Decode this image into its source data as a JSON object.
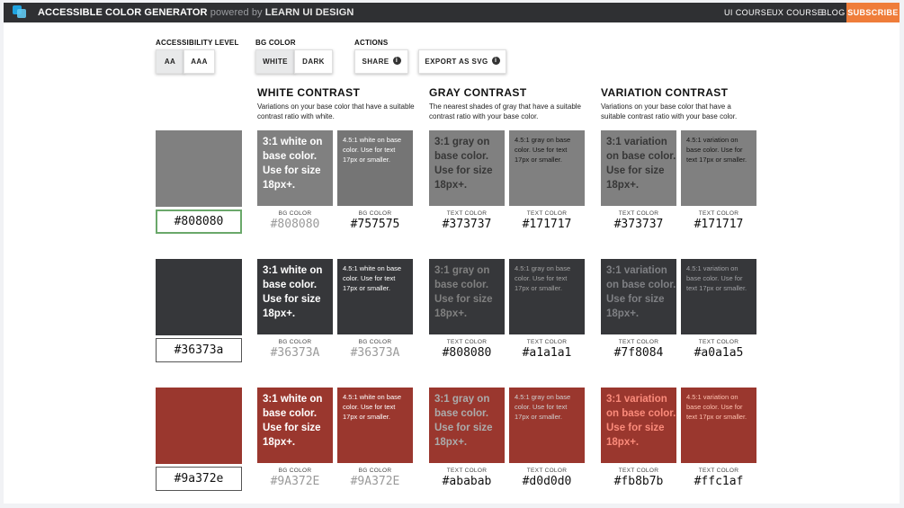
{
  "header": {
    "app_title": "ACCESSIBLE COLOR GENERATOR",
    "powered_by": "powered by",
    "brand": "LEARN UI DESIGN",
    "nav": [
      "UI COURSE",
      "UX COURSE",
      "BLOG"
    ],
    "subscribe_label": "SUBSCRIBE"
  },
  "controls": {
    "accessibility_level_label": "ACCESSIBILITY LEVEL",
    "accessibility_levels": [
      "AA",
      "AAA"
    ],
    "accessibility_selected": "AA",
    "bg_color_label": "BG COLOR",
    "bg_colors": [
      "WHITE",
      "DARK"
    ],
    "bg_selected": "WHITE",
    "actions_label": "ACTIONS",
    "share_label": "SHARE",
    "export_label": "EXPORT AS SVG",
    "info_glyph": "i"
  },
  "columns": [
    {
      "title": "WHITE CONTRAST",
      "description": "Variations on your base color that have a suitable contrast ratio with white."
    },
    {
      "title": "GRAY CONTRAST",
      "description": "The nearest shades of gray that have a suitable contrast ratio with your base color."
    },
    {
      "title": "VARIATION CONTRAST",
      "description": "Variations on your base color that have a suitable contrast ratio with your base color."
    }
  ],
  "rows": [
    {
      "base_hex": "#808080",
      "base_color": "#808080",
      "tiles": [
        {
          "bg": "#808080",
          "fg": "#ffffff",
          "text": "3:1 white on base color. Use for size 18px+.",
          "kind": "big",
          "label": "BG COLOR",
          "hex": "#808080",
          "hex_color": "#9a9a9a"
        },
        {
          "bg": "#757575",
          "fg": "#ffffff",
          "text": "4.5:1 white on base color. Use for text 17px or smaller.",
          "kind": "small",
          "label": "BG COLOR",
          "hex": "#757575",
          "hex_color": "#111111"
        },
        {
          "bg": "#808080",
          "fg": "#373737",
          "text": "3:1 gray on base color. Use for size 18px+.",
          "kind": "big",
          "label": "TEXT COLOR",
          "hex": "#373737",
          "hex_color": "#111111"
        },
        {
          "bg": "#808080",
          "fg": "#171717",
          "text": "4.5:1 gray on base color. Use for text 17px or smaller.",
          "kind": "small",
          "label": "TEXT COLOR",
          "hex": "#171717",
          "hex_color": "#111111"
        },
        {
          "bg": "#808080",
          "fg": "#373737",
          "text": "3:1 variation on base color. Use for size 18px+.",
          "kind": "big",
          "label": "TEXT COLOR",
          "hex": "#373737",
          "hex_color": "#111111"
        },
        {
          "bg": "#808080",
          "fg": "#171717",
          "text": "4.5:1 variation on base color. Use for text 17px or smaller.",
          "kind": "small",
          "label": "TEXT COLOR",
          "hex": "#171717",
          "hex_color": "#111111"
        }
      ]
    },
    {
      "base_hex": "#36373a",
      "base_color": "#36373a",
      "tiles": [
        {
          "bg": "#36373a",
          "fg": "#ffffff",
          "text": "3:1 white on base color. Use for size 18px+.",
          "kind": "big",
          "label": "BG COLOR",
          "hex": "#36373A",
          "hex_color": "#9a9a9a"
        },
        {
          "bg": "#36373a",
          "fg": "#ffffff",
          "text": "4.5:1 white on base color. Use for text 17px or smaller.",
          "kind": "small",
          "label": "BG COLOR",
          "hex": "#36373A",
          "hex_color": "#9a9a9a"
        },
        {
          "bg": "#36373a",
          "fg": "#808080",
          "text": "3:1 gray on base color. Use for size 18px+.",
          "kind": "big",
          "label": "TEXT COLOR",
          "hex": "#808080",
          "hex_color": "#111111"
        },
        {
          "bg": "#36373a",
          "fg": "#a1a1a1",
          "text": "4.5:1 gray on base color. Use for text 17px or smaller.",
          "kind": "small",
          "label": "TEXT COLOR",
          "hex": "#a1a1a1",
          "hex_color": "#111111"
        },
        {
          "bg": "#36373a",
          "fg": "#7f8084",
          "text": "3:1 variation on base color. Use for size 18px+.",
          "kind": "big",
          "label": "TEXT COLOR",
          "hex": "#7f8084",
          "hex_color": "#111111"
        },
        {
          "bg": "#36373a",
          "fg": "#a0a1a5",
          "text": "4.5:1 variation on base color. Use for text 17px or smaller.",
          "kind": "small",
          "label": "TEXT COLOR",
          "hex": "#a0a1a5",
          "hex_color": "#111111"
        }
      ]
    },
    {
      "base_hex": "#9a372e",
      "base_color": "#9a372e",
      "tiles": [
        {
          "bg": "#9a372e",
          "fg": "#ffffff",
          "text": "3:1 white on base color. Use for size 18px+.",
          "kind": "big",
          "label": "BG COLOR",
          "hex": "#9A372E",
          "hex_color": "#9a9a9a"
        },
        {
          "bg": "#9a372e",
          "fg": "#ffffff",
          "text": "4.5:1 white on base color. Use for text 17px or smaller.",
          "kind": "small",
          "label": "BG COLOR",
          "hex": "#9A372E",
          "hex_color": "#9a9a9a"
        },
        {
          "bg": "#9a372e",
          "fg": "#ababab",
          "text": "3:1 gray on base color. Use for size 18px+.",
          "kind": "big",
          "label": "TEXT COLOR",
          "hex": "#ababab",
          "hex_color": "#111111"
        },
        {
          "bg": "#9a372e",
          "fg": "#d0d0d0",
          "text": "4.5:1 gray on base color. Use for text 17px or smaller.",
          "kind": "small",
          "label": "TEXT COLOR",
          "hex": "#d0d0d0",
          "hex_color": "#111111"
        },
        {
          "bg": "#9a372e",
          "fg": "#fb8b7b",
          "text": "3:1 variation on base color. Use for size 18px+.",
          "kind": "big",
          "label": "TEXT COLOR",
          "hex": "#fb8b7b",
          "hex_color": "#111111"
        },
        {
          "bg": "#9a372e",
          "fg": "#ffc1af",
          "text": "4.5:1 variation on base color. Use for text 17px or smaller.",
          "kind": "small",
          "label": "TEXT COLOR",
          "hex": "#ffc1af",
          "hex_color": "#111111"
        }
      ]
    }
  ]
}
